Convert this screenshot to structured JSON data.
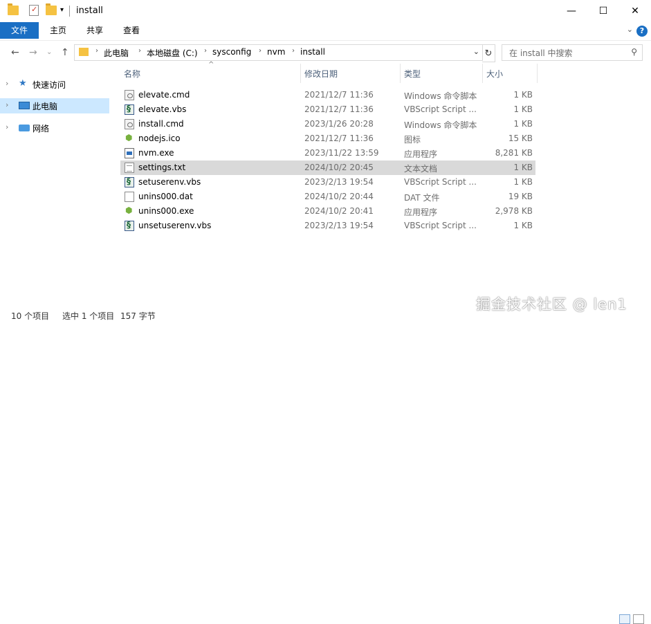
{
  "window": {
    "title": "install",
    "controls": {
      "minimize": "—",
      "maximize": "☐",
      "close": "✕"
    }
  },
  "ribbon": {
    "tabs": [
      "文件",
      "主页",
      "共享",
      "查看"
    ],
    "expand_icon": "chevron-down-icon",
    "help": "?"
  },
  "address": {
    "crumbs": [
      "此电脑",
      "本地磁盘 (C:)",
      "sysconfig",
      "nvm",
      "install"
    ],
    "search_placeholder": "在 install 中搜索"
  },
  "sidebar": {
    "items": [
      {
        "label": "快速访问",
        "icon": "star-icon",
        "selected": false
      },
      {
        "label": "此电脑",
        "icon": "computer-icon",
        "selected": true
      },
      {
        "label": "网络",
        "icon": "network-icon",
        "selected": false
      }
    ]
  },
  "columns": {
    "name": "名称",
    "date": "修改日期",
    "type": "类型",
    "size": "大小"
  },
  "files": [
    {
      "name": "elevate.cmd",
      "date": "2021/12/7 11:36",
      "type": "Windows 命令脚本",
      "size": "1 KB",
      "icon": "cmd"
    },
    {
      "name": "elevate.vbs",
      "date": "2021/12/7 11:36",
      "type": "VBScript Script ...",
      "size": "1 KB",
      "icon": "vbs"
    },
    {
      "name": "install.cmd",
      "date": "2023/1/26 20:28",
      "type": "Windows 命令脚本",
      "size": "1 KB",
      "icon": "cmd"
    },
    {
      "name": "nodejs.ico",
      "date": "2021/12/7 11:36",
      "type": "图标",
      "size": "15 KB",
      "icon": "ico"
    },
    {
      "name": "nvm.exe",
      "date": "2023/11/22 13:59",
      "type": "应用程序",
      "size": "8,281 KB",
      "icon": "exe"
    },
    {
      "name": "settings.txt",
      "date": "2024/10/2 20:45",
      "type": "文本文档",
      "size": "1 KB",
      "icon": "txt",
      "selected": true
    },
    {
      "name": "setuserenv.vbs",
      "date": "2023/2/13 19:54",
      "type": "VBScript Script ...",
      "size": "1 KB",
      "icon": "vbs"
    },
    {
      "name": "unins000.dat",
      "date": "2024/10/2 20:44",
      "type": "DAT 文件",
      "size": "19 KB",
      "icon": "dat"
    },
    {
      "name": "unins000.exe",
      "date": "2024/10/2 20:41",
      "type": "应用程序",
      "size": "2,978 KB",
      "icon": "ico"
    },
    {
      "name": "unsetuserenv.vbs",
      "date": "2023/2/13 19:54",
      "type": "VBScript Script ...",
      "size": "1 KB",
      "icon": "vbs"
    }
  ],
  "status": {
    "count": "10 个项目",
    "selection": "选中 1 个项目",
    "selection_size": "157 字节"
  },
  "watermark": "掘金技术社区 @ len1",
  "colors": {
    "accent": "#1a6fc4",
    "selected_sidebar": "#cce8ff",
    "selected_row": "#d9d9d9"
  }
}
